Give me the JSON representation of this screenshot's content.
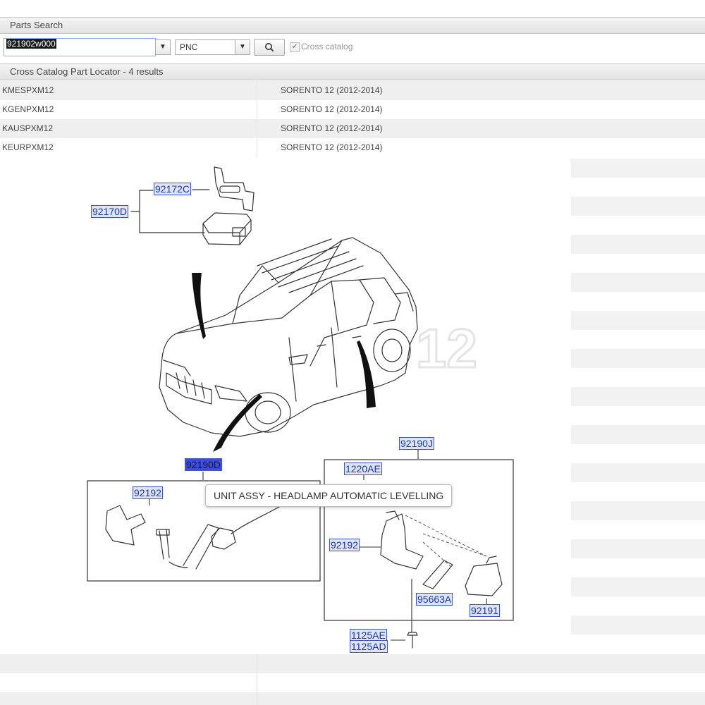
{
  "parts_search": {
    "title": "Parts Search",
    "query": "921902w000",
    "search_type": "PNC",
    "cross_catalog_label": "Cross catalog",
    "cross_catalog_checked": true
  },
  "locator": {
    "title": "Cross Catalog Part Locator - 4 results",
    "rows": [
      {
        "catalog": "KMESPXM12",
        "model": "SORENTO 12 (2012-2014)"
      },
      {
        "catalog": "KGENPXM12",
        "model": "SORENTO 12 (2012-2014)"
      },
      {
        "catalog": "KAUSPXM12",
        "model": "SORENTO 12 (2012-2014)"
      },
      {
        "catalog": "KEURPXM12",
        "model": "SORENTO 12 (2012-2014)"
      }
    ]
  },
  "diagram": {
    "watermark": "12",
    "callouts": {
      "c92172C": "92172C",
      "c92170D": "92170D",
      "c92190D": "92190D",
      "c92192a": "92192",
      "c92190J": "92190J",
      "c1220AE": "1220AE",
      "c92192b": "92192",
      "c95663A": "95663A",
      "c92191": "92191",
      "c1125AE": "1125AE",
      "c1125AD": "1125AD"
    },
    "tooltip": "UNIT ASSY - HEADLAMP AUTOMATIC LEVELLING"
  },
  "icons": [
    "dropdown-arrow-icon",
    "search-icon",
    "checkmark-icon"
  ]
}
